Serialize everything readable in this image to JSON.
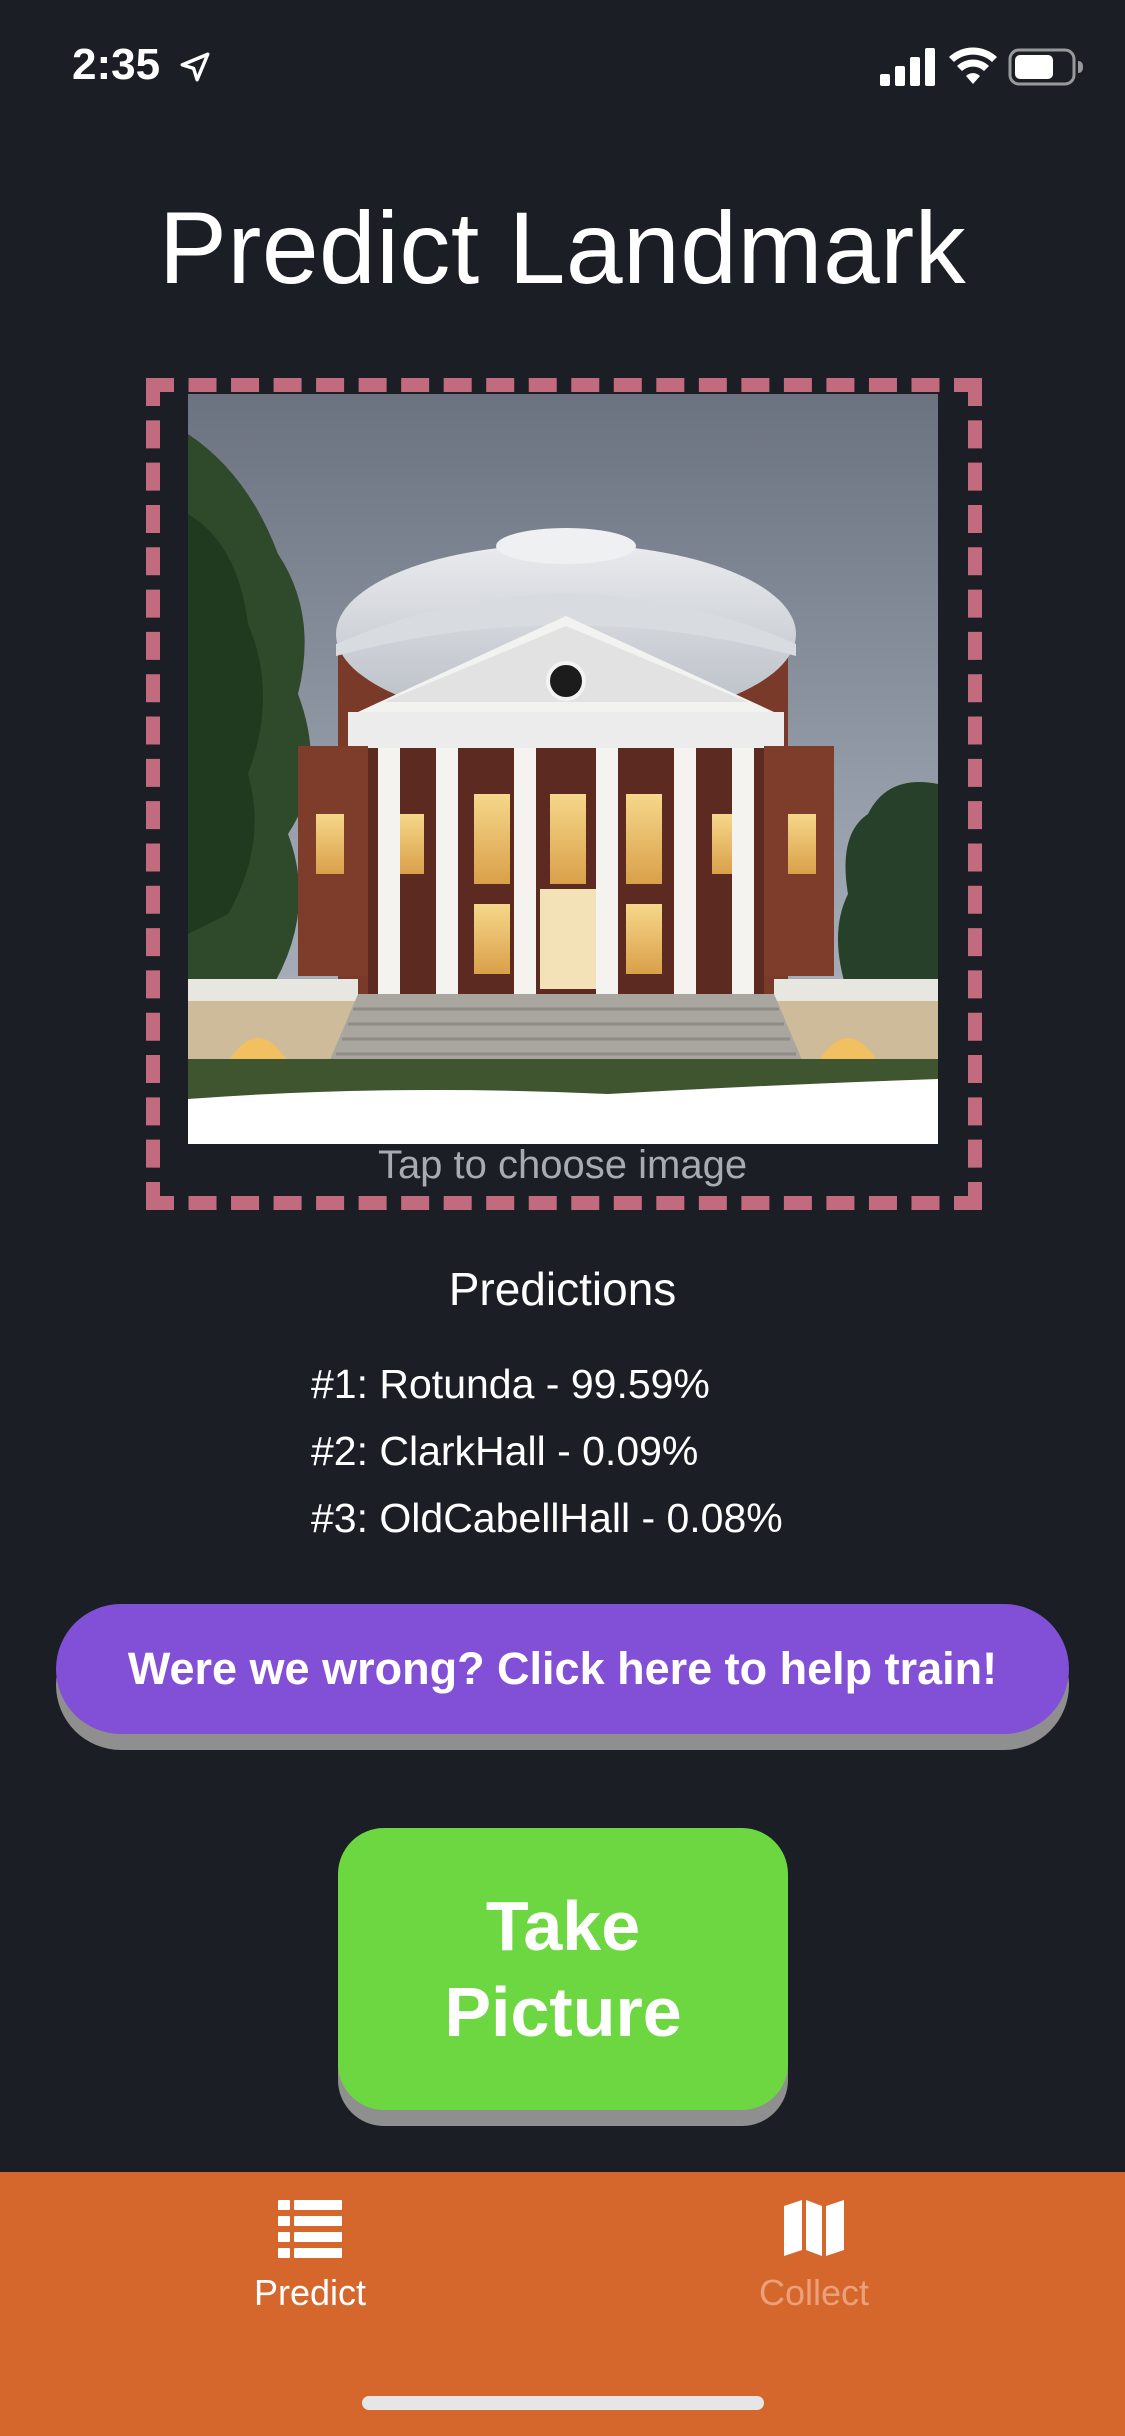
{
  "status_bar": {
    "time": "2:35",
    "icons": [
      "location-arrow-icon",
      "signal-icon",
      "wifi-icon",
      "battery-icon"
    ]
  },
  "header": {
    "title": "Predict Landmark"
  },
  "image_picker": {
    "hint": "Tap to choose image",
    "border_color": "#c36b7e"
  },
  "predictions": {
    "heading": "Predictions",
    "items": [
      "#1: Rotunda - 99.59%",
      "#2: ClarkHall - 0.09%",
      "#3: OldCabellHall - 0.08%"
    ]
  },
  "help_button": {
    "label": "Were we wrong? Click here to help train!",
    "color": "#8250d6"
  },
  "take_picture_button": {
    "line1": "Take",
    "line2": "Picture",
    "color": "#6dd741"
  },
  "tab_bar": {
    "color": "#d6672c",
    "tabs": [
      {
        "label": "Predict",
        "icon": "list-icon",
        "active": true
      },
      {
        "label": "Collect",
        "icon": "map-icon",
        "active": false
      }
    ]
  }
}
